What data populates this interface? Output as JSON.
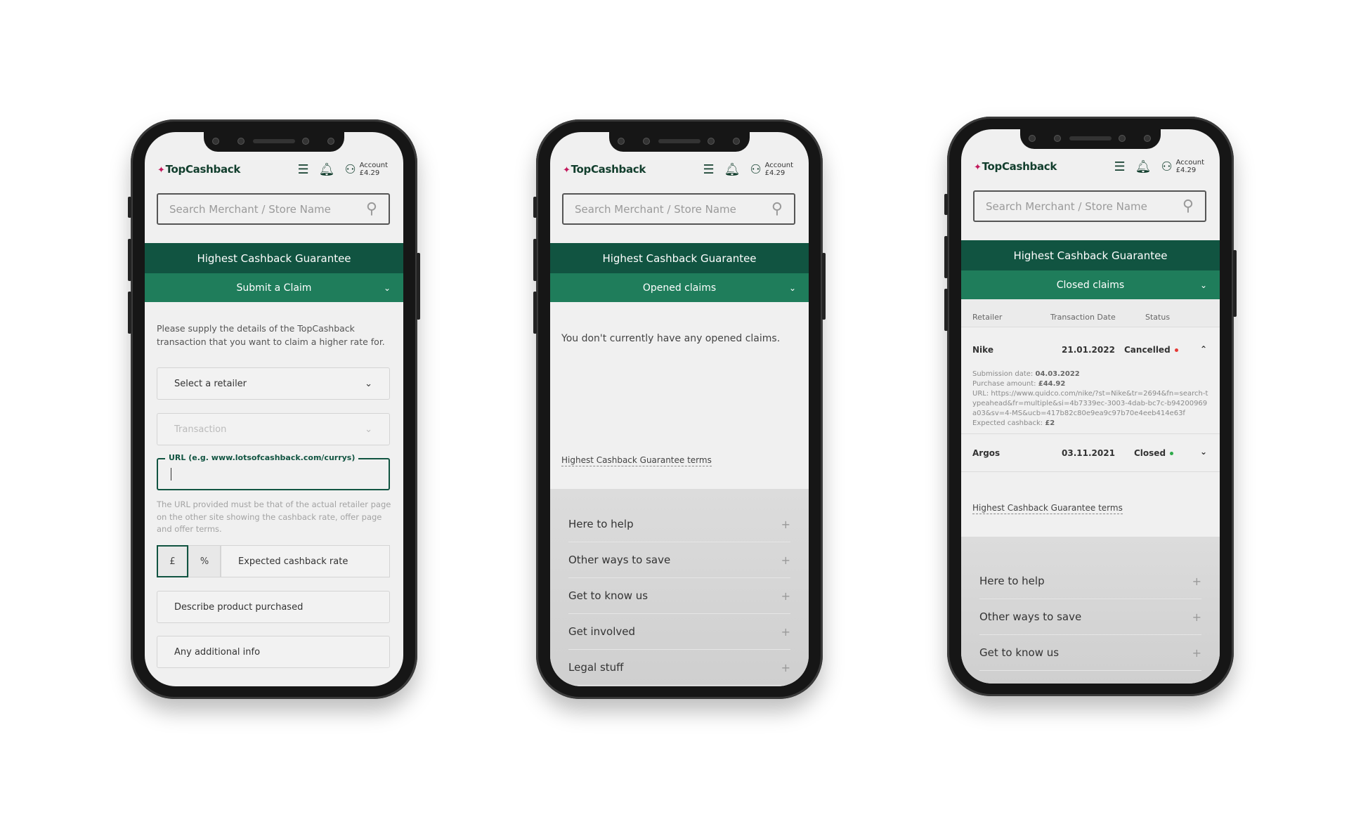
{
  "header": {
    "logo": "TopCashback",
    "account_label": "Account",
    "balance": "£4.29",
    "search_placeholder": "Search Merchant / Store Name"
  },
  "banner": "Highest Cashback Guarantee",
  "colors": {
    "dark_green": "#115441",
    "green": "#1f7d5b",
    "cancelled": "#e53935",
    "closed": "#2eaa4a"
  },
  "phone1": {
    "section": "Submit a Claim",
    "intro": "Please supply the details of the TopCashback transaction that you want to claim a higher rate for.",
    "retailer_select": "Select a retailer",
    "transaction_select": "Transaction",
    "url_label": "URL (e.g. www.lotsofcashback.com/currys)",
    "url_value": "",
    "url_hint": "The URL provided must be that of the actual retailer page on the other site showing the cashback rate, offer page and offer terms.",
    "pound": "£",
    "percent": "%",
    "rate_placeholder": "Expected cashback rate",
    "product_placeholder": "Describe product purchased",
    "info_placeholder": "Any additional info"
  },
  "phone2": {
    "section": "Opened claims",
    "empty": "You don't currently have any opened claims.",
    "terms": "Highest Cashback Guarantee terms",
    "footer": [
      "Here to help",
      "Other ways to save",
      "Get to know us",
      "Get involved",
      "Legal stuff"
    ]
  },
  "phone3": {
    "section": "Closed claims",
    "columns": [
      "Retailer",
      "Transaction Date",
      "Status"
    ],
    "rows": [
      {
        "retailer": "Nike",
        "date": "21.01.2022",
        "status": "Cancelled",
        "submission_label": "Submission date:",
        "submission": "04.03.2022",
        "amount_label": "Purchase amount:",
        "amount": "£44.92",
        "url": "URL: https://www.quidco.com/nike/?st=Nike&tr=2694&fn=search-typeahead&fr=multiple&si=4b7339ec-3003-4dab-bc7c-b94200969a03&sv=4-MS&ucb=417b82c80e9ea9c97b70e4eeb414e63f",
        "expected_label": "Expected cashback:",
        "expected": "£2"
      },
      {
        "retailer": "Argos",
        "date": "03.11.2021",
        "status": "Closed"
      }
    ],
    "terms": "Highest Cashback Guarantee terms",
    "footer": [
      "Here to help",
      "Other ways to save",
      "Get to know us"
    ]
  }
}
